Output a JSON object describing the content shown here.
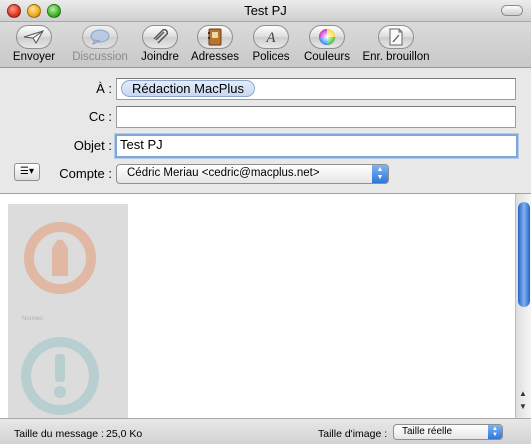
{
  "window": {
    "title": "Test PJ"
  },
  "toolbar": {
    "items": [
      {
        "label": "Envoyer",
        "icon": "send-icon",
        "enabled": true
      },
      {
        "label": "Discussion",
        "icon": "chat-bubble-icon",
        "enabled": false
      },
      {
        "label": "Joindre",
        "icon": "paperclip-icon",
        "enabled": true
      },
      {
        "label": "Adresses",
        "icon": "address-book-icon",
        "enabled": true
      },
      {
        "label": "Polices",
        "icon": "font-icon",
        "enabled": true
      },
      {
        "label": "Couleurs",
        "icon": "color-wheel-icon",
        "enabled": true
      },
      {
        "label": "Enr. brouillon",
        "icon": "draft-icon",
        "enabled": true
      }
    ]
  },
  "fields": {
    "to_label": "À :",
    "to_value": "Rédaction MacPlus",
    "cc_label": "Cc :",
    "cc_value": "",
    "subject_label": "Objet :",
    "subject_value": "Test PJ",
    "account_label": "Compte :",
    "account_value": "Cédric Meriau <cedric@macplus.net>"
  },
  "attachment": {
    "caption": "Normes"
  },
  "status": {
    "size_label": "Taille du message :",
    "size_value": "25,0 Ko",
    "image_size_label": "Taille d'image :",
    "image_size_value": "Taille réelle"
  },
  "colors": {
    "accent": "#2f77d8",
    "token_bg": "#d3e0f4"
  }
}
